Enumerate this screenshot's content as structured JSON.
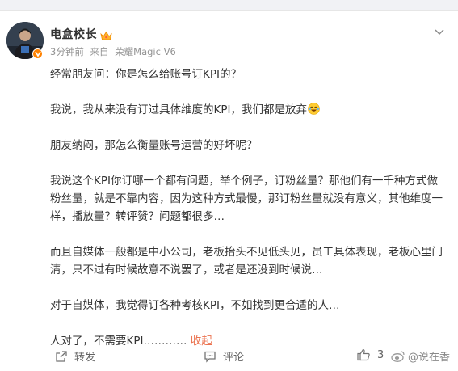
{
  "user": {
    "name": "电盒校长"
  },
  "meta": {
    "time": "3分钟前",
    "from_prefix": "来自",
    "device": "荣耀Magic V6"
  },
  "post": {
    "p1": "经常朋友问：你是怎么给账号订KPI的？",
    "p2": "我说，我从来没有订过具体维度的KPI，我们都是放弃",
    "p3": "朋友纳闷，那怎么衡量账号运营的好坏呢？",
    "p4": "我说这个KPI你订哪一个都有问题，举个例子，订粉丝量？那他们有一千种方式做粉丝量，就是不靠内容，因为这种方式最慢，那订粉丝量就没有意义，其他维度一样，播放量？转评赞？问题都很多…",
    "p5": "而且自媒体一般都是中小公司，老板抬头不见低头见，员工具体表现，老板心里门清，只不过有时候故意不说罢了，或者是还没到时候说…",
    "p6": "对于自媒体，我觉得订各种考核KPI，不如找到更合适的人…",
    "p7": "人对了，不需要KPI…………",
    "collapse": "收起"
  },
  "actions": {
    "repost": "转发",
    "comment": "评论",
    "like_count": "3"
  },
  "watermark": "@说在香",
  "colors": {
    "badge": "#ff8200",
    "link": "#eb7350"
  }
}
